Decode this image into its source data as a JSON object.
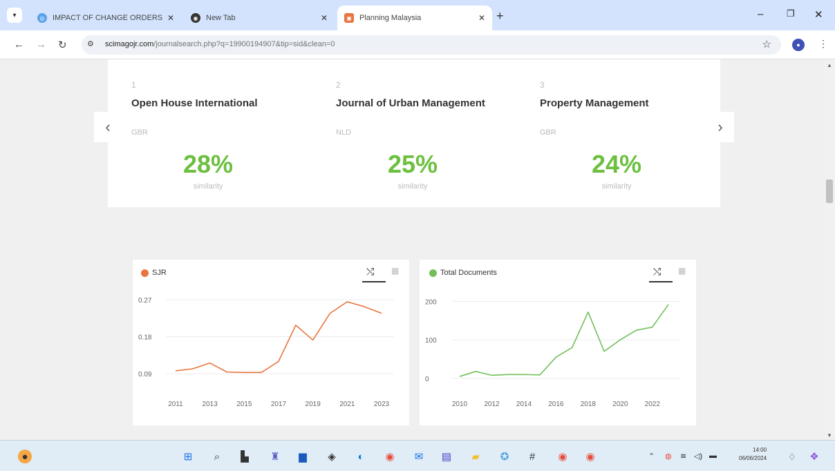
{
  "browser": {
    "tabs": [
      {
        "title": "IMPACT OF CHANGE ORDERS",
        "icon": "globe-icon"
      },
      {
        "title": "New Tab",
        "icon": "chrome-icon"
      },
      {
        "title": "Planning Malaysia",
        "icon": "journal-icon",
        "active": true
      }
    ],
    "url": {
      "host": "scimagojr.com",
      "path": "/journalsearch.php?q=19900194907&tip=sid&clean=0"
    }
  },
  "similar_journals": [
    {
      "rank": "1",
      "name": "Open House International",
      "country": "GBR",
      "similarity": "28%",
      "label": "similarity"
    },
    {
      "rank": "2",
      "name": "Journal of Urban Management",
      "country": "NLD",
      "similarity": "25%",
      "label": "similarity"
    },
    {
      "rank": "3",
      "name": "Property Management",
      "country": "GBR",
      "similarity": "24%",
      "label": "similarity"
    }
  ],
  "colors": {
    "accent_green": "#6cbf3f",
    "sjr_line": "#e8753f",
    "docs_line": "#72bf5a"
  },
  "chart_data": [
    {
      "type": "line",
      "legend": "SJR",
      "x": [
        2011,
        2012,
        2013,
        2014,
        2015,
        2016,
        2017,
        2018,
        2019,
        2020,
        2021,
        2022,
        2023
      ],
      "series": [
        {
          "name": "SJR",
          "values": [
            0.097,
            0.102,
            0.116,
            0.094,
            0.093,
            0.093,
            0.12,
            0.208,
            0.172,
            0.237,
            0.265,
            0.253,
            0.237
          ]
        }
      ],
      "ylim": [
        0.06,
        0.28
      ],
      "yticks": [
        "0.27",
        "0.18",
        "0.09"
      ],
      "ytick_values": [
        0.27,
        0.18,
        0.09
      ],
      "xticks": [
        "2011",
        "2013",
        "2015",
        "2017",
        "2019",
        "2021",
        "2023"
      ]
    },
    {
      "type": "line",
      "legend": "Total Documents",
      "x": [
        2010,
        2011,
        2012,
        2013,
        2014,
        2015,
        2016,
        2017,
        2018,
        2019,
        2020,
        2021,
        2022,
        2023
      ],
      "series": [
        {
          "name": "Total Documents",
          "values": [
            5,
            18,
            8,
            10,
            10,
            9,
            55,
            80,
            172,
            70,
            100,
            125,
            133,
            192
          ]
        }
      ],
      "ylim": [
        -20,
        215
      ],
      "yticks": [
        "200",
        "100",
        "0"
      ],
      "ytick_values": [
        200,
        100,
        0
      ],
      "xticks": [
        "2010",
        "2012",
        "2014",
        "2016",
        "2018",
        "2020",
        "2022"
      ]
    }
  ],
  "taskbar": {
    "time": "14:00",
    "date": "06/06/2024"
  }
}
